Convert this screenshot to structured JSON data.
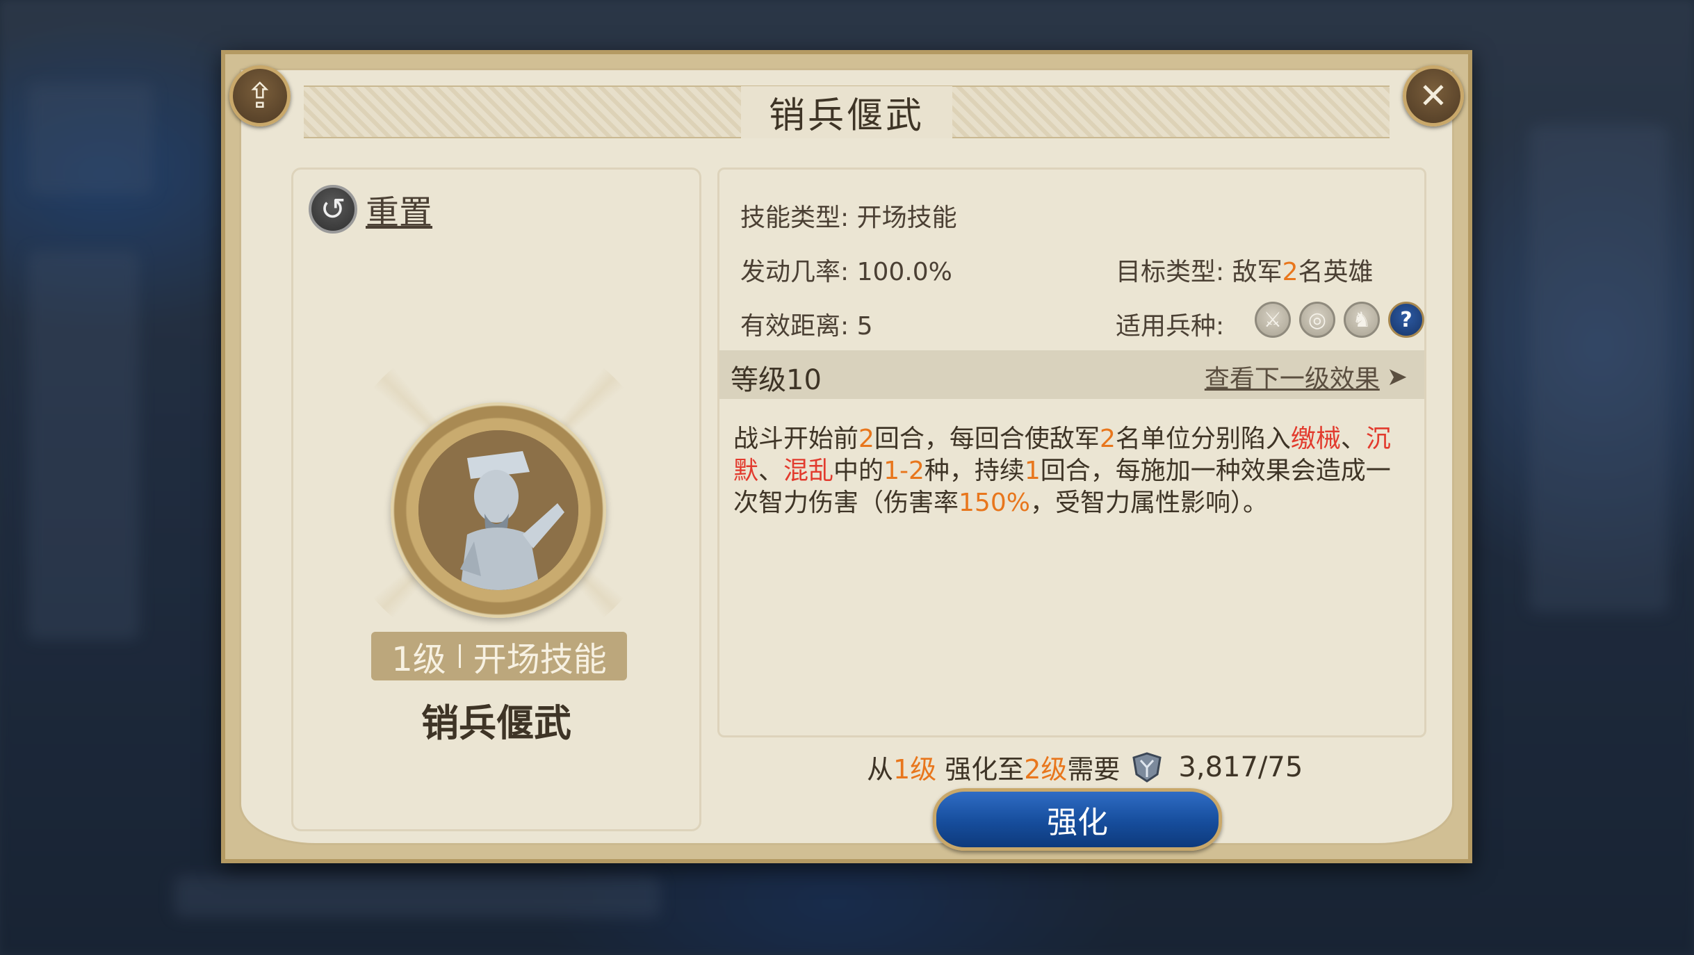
{
  "dialog": {
    "title": "销兵偃武"
  },
  "left": {
    "reset_label": "重置",
    "badge_level": "1级",
    "badge_type": "开场技能",
    "skill_name": "销兵偃武"
  },
  "attributes": {
    "skill_type_label": "技能类型:",
    "skill_type_value": "开场技能",
    "trigger_rate_label": "发动几率:",
    "trigger_rate_value": "100.0%",
    "range_label": "有效距离:",
    "range_value": "5",
    "target_label": "目标类型:",
    "target_prefix": "敌军",
    "target_count": "2",
    "target_suffix": "名英雄",
    "units_label": "适用兵种:"
  },
  "unit_icons": [
    "sword-icon",
    "target-bow-icon",
    "horse-icon",
    "question-icon"
  ],
  "level_bar": {
    "level": "等级10",
    "next_link": "查看下一级效果",
    "arrow": "➤"
  },
  "description": {
    "p1": "战斗开始前",
    "n1": "2",
    "p2": "回合，每回合使敌军",
    "n2": "2",
    "p3": "名单位分别陷入",
    "s1": "缴械",
    "p4": "、",
    "s2": "沉默",
    "p5": "、",
    "s3": "混乱",
    "p6": "中的",
    "n3": "1-2",
    "p7": "种，持续",
    "n4": "1",
    "p8": "回合，每施加一种效果会造成一次智力伤害（伤害率",
    "n5": "150%",
    "p9": "，受智力属性影响）。"
  },
  "cost": {
    "from": "从",
    "from_level": "1级",
    "mid": "强化至",
    "to_level": "2级",
    "need": "需要",
    "value": "3,817/75"
  },
  "upgrade_button": "强化",
  "colors": {
    "highlight_orange": "#e8761c",
    "highlight_red": "#e23b2e",
    "button_blue": "#164d9c",
    "frame_gold": "#c9a86a"
  }
}
